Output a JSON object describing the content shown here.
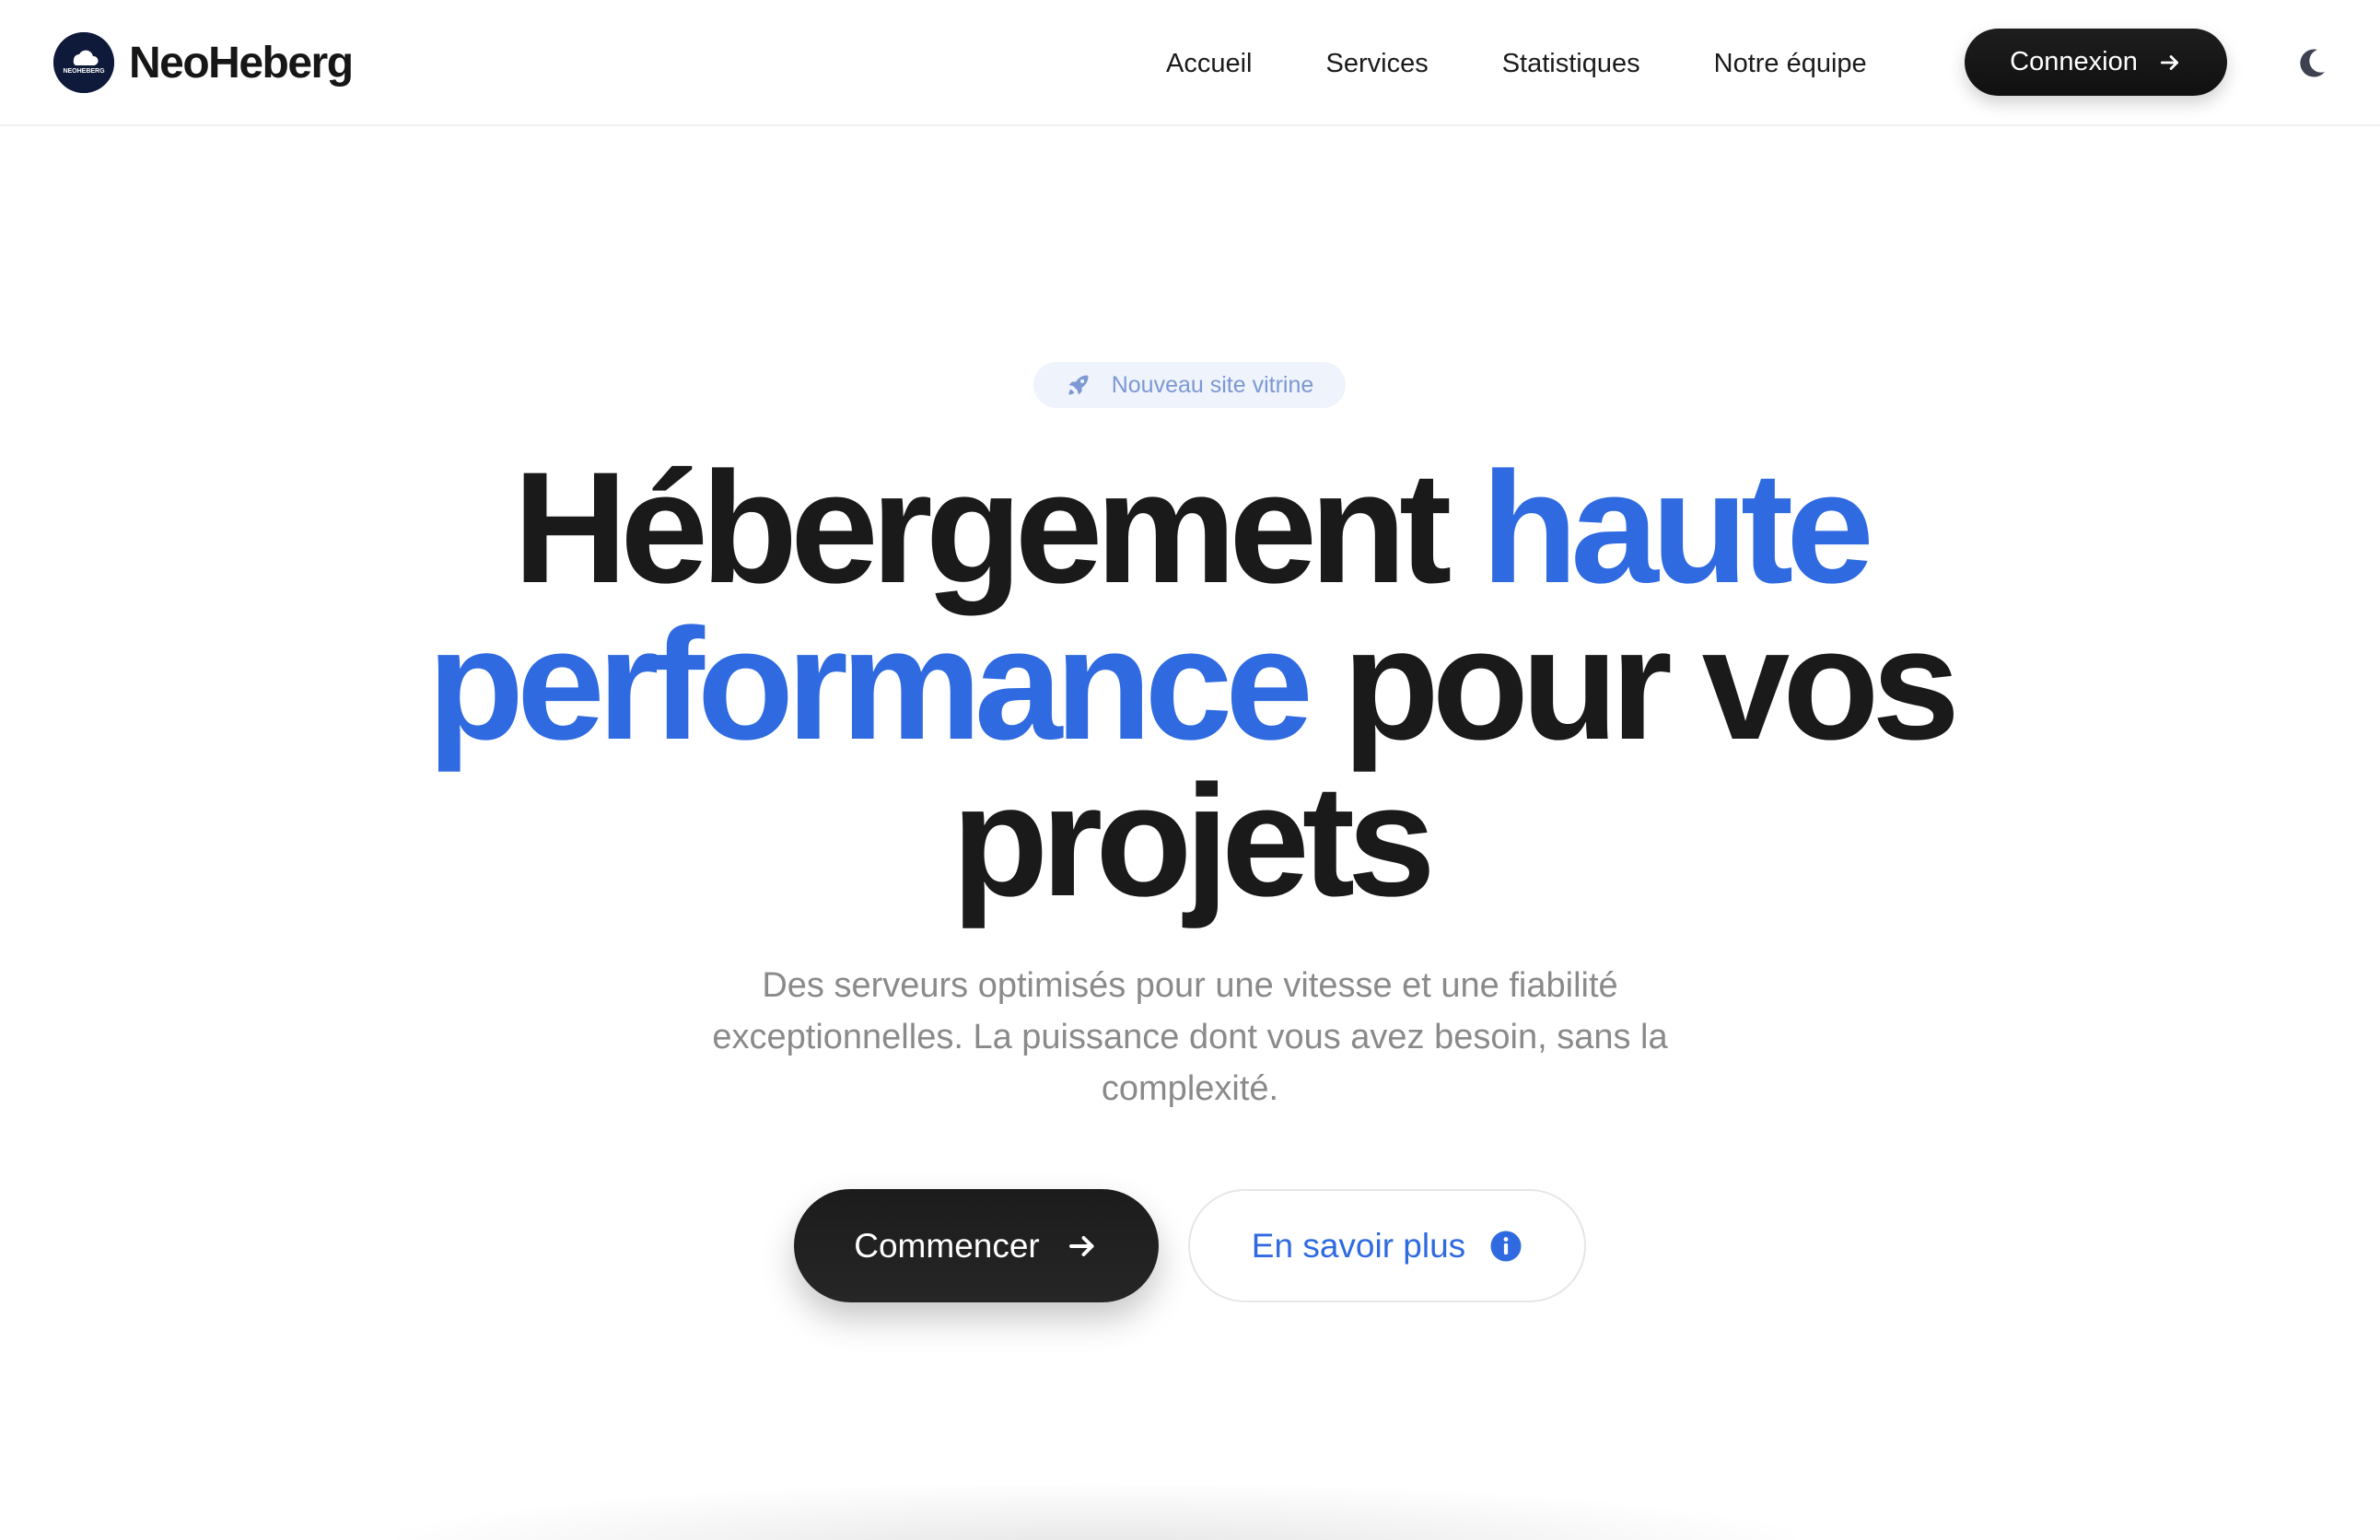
{
  "header": {
    "brand_name": "NeoHeberg",
    "logo_text": "NEOHEBERG",
    "logo_icon": "cloud-icon",
    "nav": [
      {
        "label": "Accueil"
      },
      {
        "label": "Services"
      },
      {
        "label": "Statistiques"
      },
      {
        "label": "Notre équipe"
      }
    ],
    "login_label": "Connexion",
    "login_icon": "arrow-right-icon",
    "theme_icon": "moon-icon"
  },
  "hero": {
    "badge_icon": "rocket-icon",
    "badge_label": "Nouveau site vitrine",
    "title_part1": "Hébergement ",
    "title_accent": "haute performance",
    "title_part2": " pour vos projets",
    "subtitle": "Des serveurs optimisés pour une vitesse et une fiabilité exceptionnelles. La puissance dont vous avez besoin, sans la complexité.",
    "primary_label": "Commencer",
    "primary_icon": "arrow-right-icon",
    "secondary_label": "En savoir plus",
    "secondary_icon": "info-circle-icon"
  },
  "colors": {
    "accent": "#2f6ae0",
    "dark": "#1a1a1a",
    "muted_text": "#8a8a8a",
    "badge_bg": "#eef3fc",
    "badge_text": "#7d98d2",
    "logo_bg": "#0f1a3a"
  }
}
